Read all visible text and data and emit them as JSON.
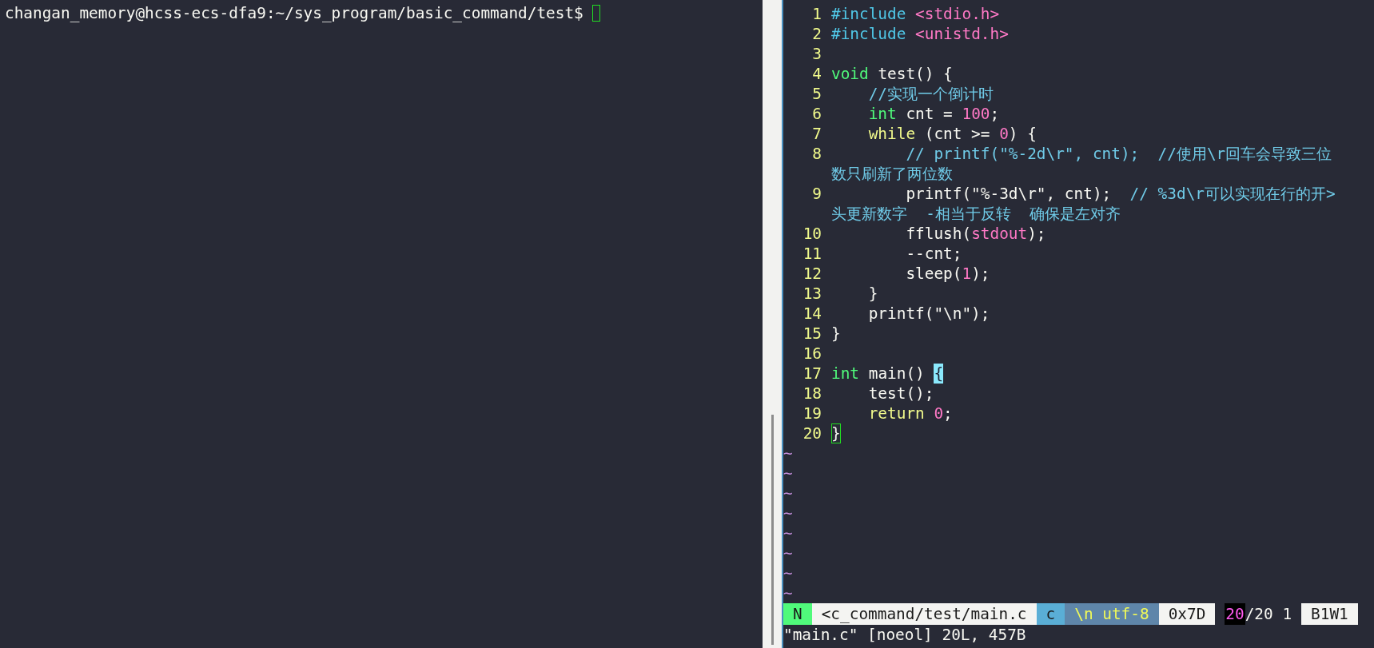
{
  "terminal": {
    "prompt": "changan_memory@hcss-ecs-dfa9:~/sys_program/basic_command/test$ "
  },
  "editor": {
    "lines": [
      {
        "number": "1",
        "tokens": [
          {
            "text": "#include",
            "kind": "pre"
          },
          {
            "text": " <stdio.h>",
            "kind": "str"
          }
        ]
      },
      {
        "number": "2",
        "tokens": [
          {
            "text": "#include",
            "kind": "pre"
          },
          {
            "text": " <unistd.h>",
            "kind": "str"
          }
        ]
      },
      {
        "number": "3"
      },
      {
        "number": "4",
        "tokens": [
          {
            "text": "void",
            "kind": "type"
          },
          {
            "text": " test() {",
            "kind": "plain"
          }
        ]
      },
      {
        "number": "5",
        "tokens": [
          {
            "text": "    //实现一个倒计时",
            "kind": "comment"
          }
        ]
      },
      {
        "number": "6",
        "tokens": [
          {
            "text": "    int",
            "kind": "type"
          },
          {
            "text": " cnt = ",
            "kind": "plain"
          },
          {
            "text": "100",
            "kind": "num"
          },
          {
            "text": ";",
            "kind": "plain"
          }
        ]
      },
      {
        "number": "7",
        "tokens": [
          {
            "text": "    while",
            "kind": "kw"
          },
          {
            "text": " (cnt >= ",
            "kind": "plain"
          },
          {
            "text": "0",
            "kind": "num"
          },
          {
            "text": ") {",
            "kind": "plain"
          }
        ]
      },
      {
        "number": "8",
        "tokens": [
          {
            "text": "        // printf(\"%-2d\\r\", cnt);  //使用\\r回车会导致三位",
            "kind": "comment"
          }
        ],
        "continuation": [
          {
            "text": "数只刷新了两位数",
            "kind": "comment"
          }
        ]
      },
      {
        "number": "9",
        "tokens": [
          {
            "text": "        printf(\"%-3d\\r\", cnt);",
            "kind": "plain"
          },
          {
            "text": "  // %3d\\r可以实现在行的开>",
            "kind": "comment"
          }
        ],
        "continuation": [
          {
            "text": "头更新数字  -相当于反转  确保是左对齐",
            "kind": "comment"
          }
        ]
      },
      {
        "number": "10",
        "tokens": [
          {
            "text": "        fflush(",
            "kind": "plain"
          },
          {
            "text": "stdout",
            "kind": "str"
          },
          {
            "text": ");",
            "kind": "plain"
          }
        ]
      },
      {
        "number": "11",
        "tokens": [
          {
            "text": "        --cnt;",
            "kind": "plain"
          }
        ]
      },
      {
        "number": "12",
        "tokens": [
          {
            "text": "        sleep(",
            "kind": "plain"
          },
          {
            "text": "1",
            "kind": "num"
          },
          {
            "text": ");",
            "kind": "plain"
          }
        ]
      },
      {
        "number": "13",
        "tokens": [
          {
            "text": "    }",
            "kind": "plain"
          }
        ]
      },
      {
        "number": "14",
        "tokens": [
          {
            "text": "    printf(\"\\n\");",
            "kind": "plain"
          }
        ]
      },
      {
        "number": "15",
        "tokens": [
          {
            "text": "}",
            "kind": "plain"
          }
        ]
      },
      {
        "number": "16"
      },
      {
        "number": "17",
        "tokens": [
          {
            "text": "int",
            "kind": "type"
          },
          {
            "text": " main() ",
            "kind": "plain"
          },
          {
            "text": "{",
            "kind": "plain",
            "match": true
          }
        ]
      },
      {
        "number": "18",
        "tokens": [
          {
            "text": "    test();",
            "kind": "plain"
          }
        ]
      },
      {
        "number": "19",
        "tokens": [
          {
            "text": "    return",
            "kind": "kw"
          },
          {
            "text": " 0",
            "kind": "num"
          },
          {
            "text": ";",
            "kind": "plain"
          }
        ]
      },
      {
        "number": "20",
        "tokens": [
          {
            "text": "}",
            "kind": "plain",
            "cursor": true
          }
        ]
      }
    ],
    "tildes": [
      "~",
      "~",
      "~",
      "~",
      "~",
      "~",
      "~",
      "~"
    ],
    "status_bar": [
      {
        "text": "N",
        "kind": "mode"
      },
      {
        "text": "<c_command/test/main.c",
        "kind": "file"
      },
      {
        "text": "c",
        "kind": "filetype"
      },
      {
        "text": "\\n utf-8",
        "kind": "encoding"
      },
      {
        "text": "0x7D",
        "kind": "hex"
      },
      {
        "text": "20",
        "kind": "current-line"
      },
      {
        "text": "/20 1",
        "kind": "position"
      },
      {
        "text": "B1W1",
        "kind": "buffer"
      }
    ],
    "message": "\"main.c\" [noeol] 20L, 457B"
  }
}
